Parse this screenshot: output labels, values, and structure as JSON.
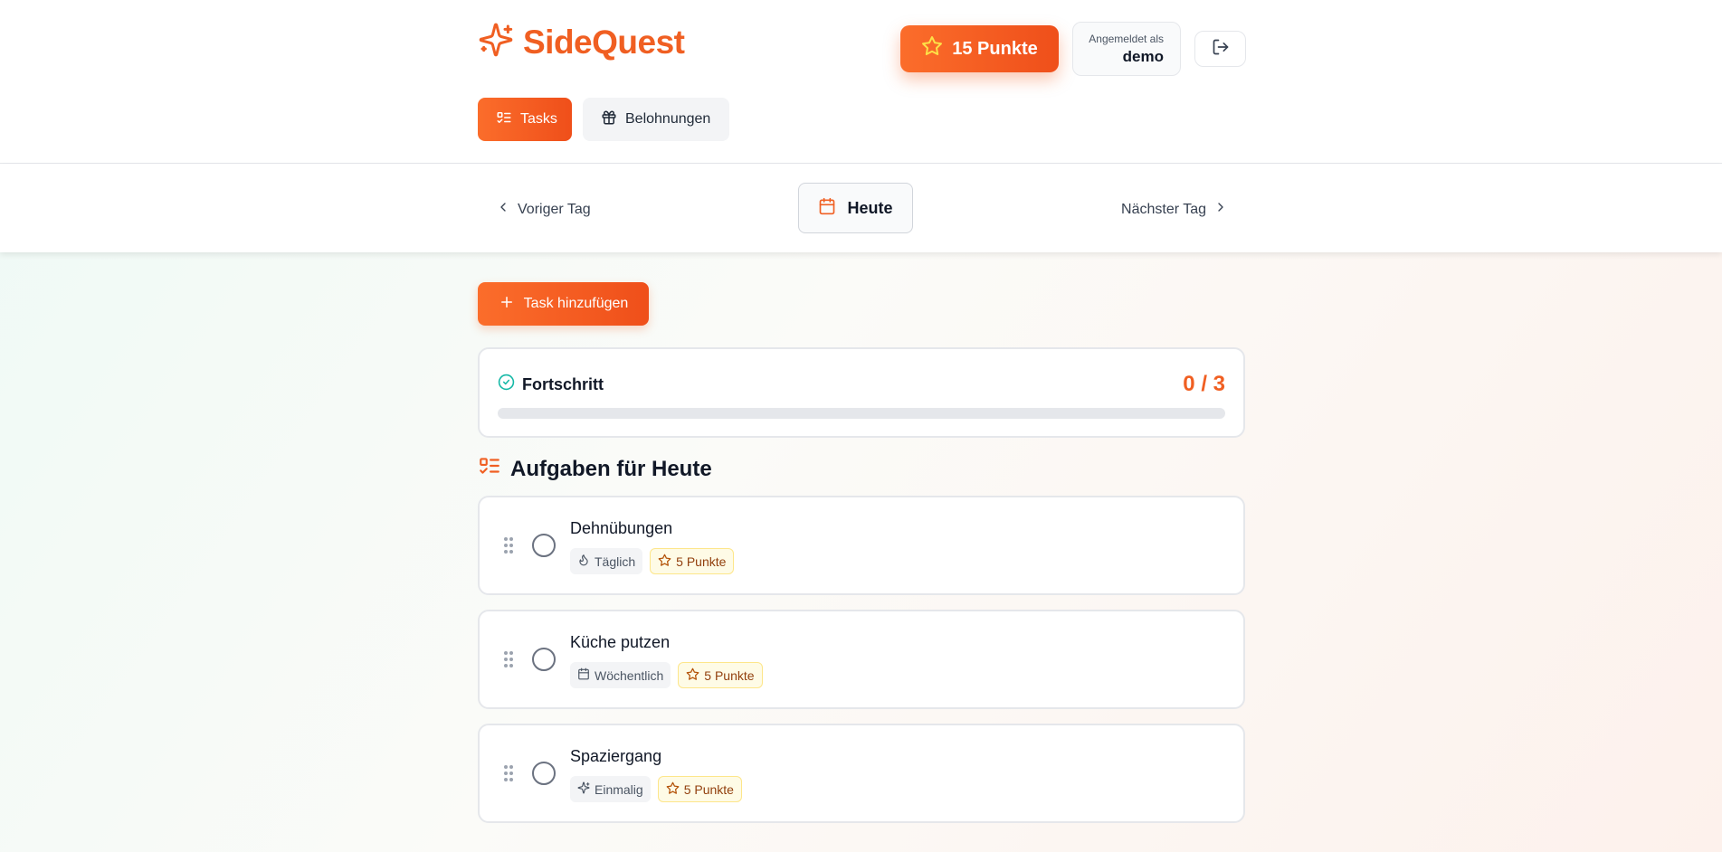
{
  "app": {
    "name": "SideQuest"
  },
  "header": {
    "points_label": "15 Punkte",
    "user": {
      "caption": "Angemeldet als",
      "name": "demo"
    }
  },
  "nav": {
    "tabs": [
      {
        "label": "Tasks",
        "active": true
      },
      {
        "label": "Belohnungen",
        "active": false
      }
    ]
  },
  "day_nav": {
    "prev": "Voriger Tag",
    "current": "Heute",
    "next": "Nächster Tag"
  },
  "actions": {
    "add_task": "Task hinzufügen"
  },
  "progress": {
    "title": "Fortschritt",
    "count": "0 / 3",
    "completed": 0,
    "total": 3
  },
  "tasks_section": {
    "title": "Aufgaben für Heute"
  },
  "tasks": [
    {
      "name": "Dehnübungen",
      "type": "Täglich",
      "type_icon": "flame-icon",
      "points": "5 Punkte",
      "done": false
    },
    {
      "name": "Küche putzen",
      "type": "Wöchentlich",
      "type_icon": "calendar-icon",
      "points": "5 Punkte",
      "done": false
    },
    {
      "name": "Spaziergang",
      "type": "Einmalig",
      "type_icon": "sparkles-icon",
      "points": "5 Punkte",
      "done": false
    }
  ],
  "colors": {
    "accent": "#f05f22",
    "accent_light": "#fb6d2b",
    "success": "#14b8a6",
    "points_badge_bg": "#fefbe6"
  }
}
